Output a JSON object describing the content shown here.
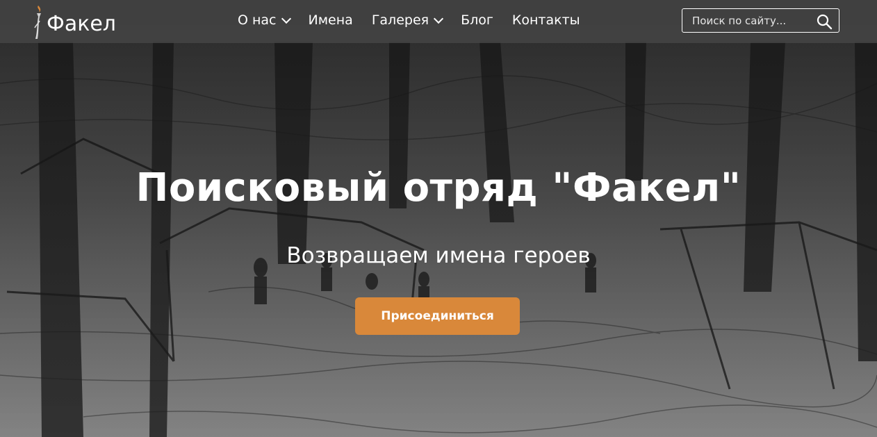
{
  "header": {
    "logo_text": "Факел",
    "nav": [
      {
        "label": "О нас",
        "has_dropdown": true
      },
      {
        "label": "Имена",
        "has_dropdown": false
      },
      {
        "label": "Галерея",
        "has_dropdown": true
      },
      {
        "label": "Блог",
        "has_dropdown": false
      },
      {
        "label": "Контакты",
        "has_dropdown": false
      }
    ],
    "search": {
      "placeholder": "Поиск по сайту...",
      "value": "",
      "icon": "search-icon"
    }
  },
  "hero": {
    "title": "Поисковый отряд \"Факел\"",
    "subtitle": "Возвращаем имена героев",
    "cta_label": "Присоединиться",
    "background": "pencil-sketch-forest-camp"
  },
  "colors": {
    "accent": "#d9883a",
    "header_bg": "#464646",
    "text": "#ffffff"
  }
}
